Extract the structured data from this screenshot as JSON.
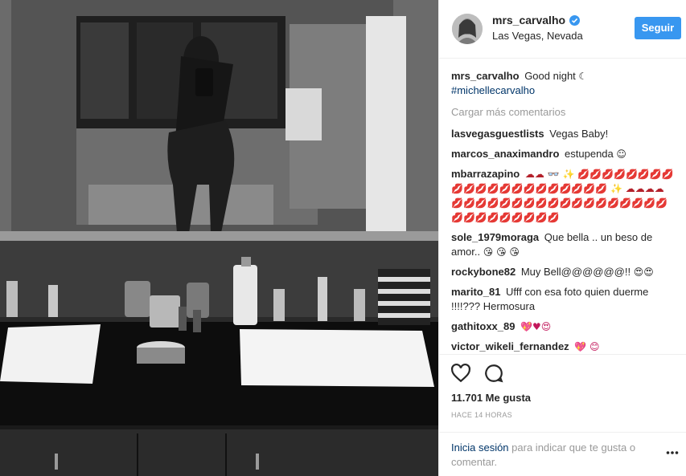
{
  "post": {
    "username": "mrs_carvalho",
    "location": "Las Vegas, Nevada",
    "follow_label": "Seguir",
    "caption_text": "Good night",
    "caption_emoji": "☾",
    "hashtag": "#michellecarvalho",
    "load_more": "Cargar más comentarios"
  },
  "comments": [
    {
      "user": "lasvegasguestlists",
      "text": "Vegas Baby!",
      "emoji": ""
    },
    {
      "user": "marcos_anaximandro",
      "text": "estupenda",
      "emoji": "☺"
    },
    {
      "user": "mbarrazapino",
      "text": "",
      "emoji": "☁☁ 👓 ✨ 💋💋💋💋💋💋💋💋💋💋💋💋💋💋💋💋💋💋💋💋💋 ✨ ☁☁☁☁ 💋💋💋💋💋💋💋💋💋💋💋💋💋💋💋💋💋💋💋💋💋💋💋💋💋💋💋"
    },
    {
      "user": "sole_1979moraga",
      "text": "Que bella .. un beso de amor..",
      "emoji": "😘 😘 😘"
    },
    {
      "user": "rockybone82",
      "text": "Muy Bell@@@@@@!!",
      "emoji": "😍😍"
    },
    {
      "user": "marito_81",
      "text": "Ufff con esa foto quien duerme !!!!??? Hermosura",
      "emoji": ""
    },
    {
      "user": "gathitoxx_89",
      "text": "",
      "emoji": "💖♥😍"
    },
    {
      "user": "victor_wikeli_fernandez",
      "text": "",
      "emoji": "💖 😊"
    }
  ],
  "actions": {
    "likes": "11.701 Me gusta",
    "time": "HACE 14 HORAS",
    "login_link": "Inicia sesión",
    "login_rest": "para indicar que te gusta o comentar."
  },
  "icons": {
    "like": "heart-icon",
    "comment": "comment-bubble-icon",
    "verified": "verified-badge-icon",
    "more": "more-options-icon"
  },
  "colors": {
    "accent": "#3897f0",
    "link": "#003569",
    "muted": "#999999"
  }
}
